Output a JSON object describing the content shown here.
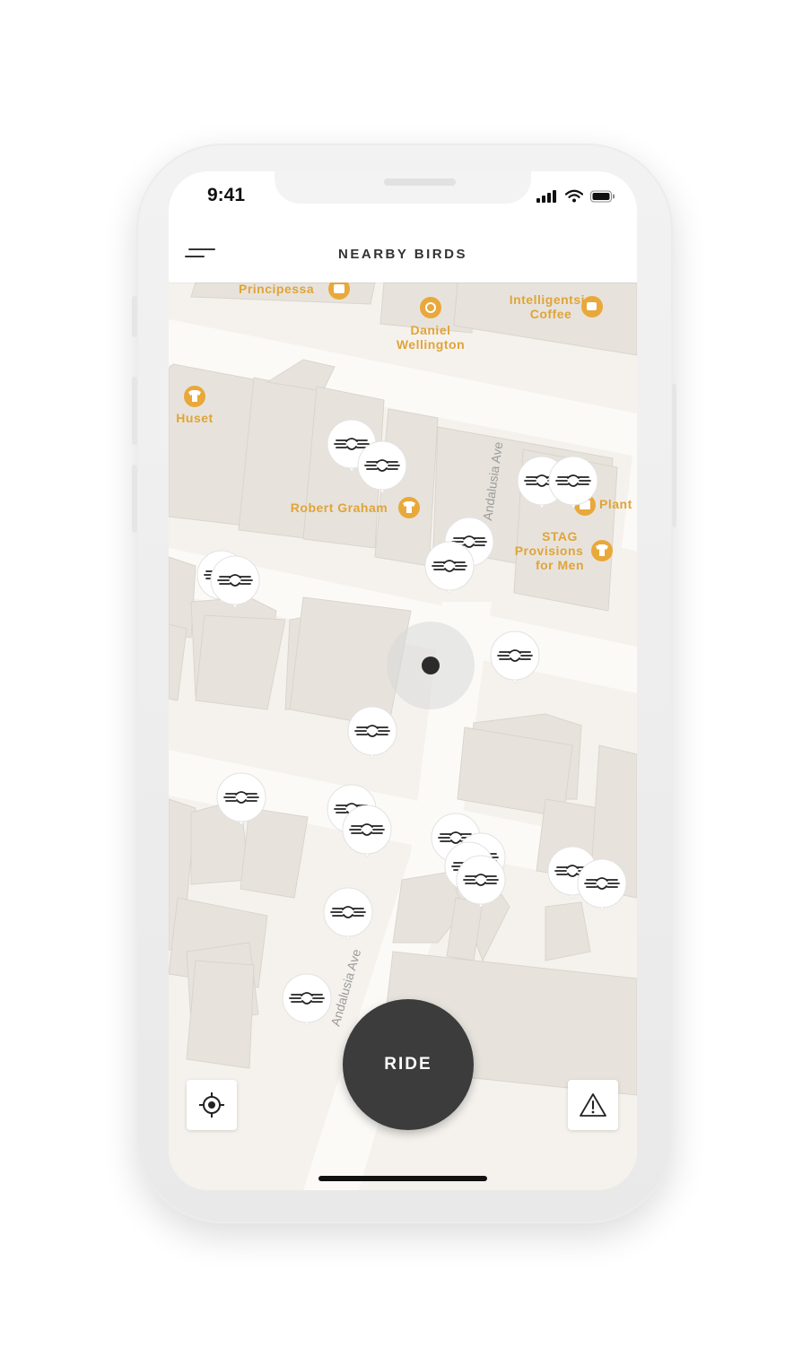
{
  "status_bar": {
    "time": "9:41"
  },
  "header": {
    "title": "NEARBY BIRDS",
    "menu_icon": "menu-icon"
  },
  "map": {
    "pois": [
      {
        "label": "Principessa",
        "icon": "bag-icon"
      },
      {
        "label": "Daniel",
        "label2": "Wellington",
        "icon": "watch-icon"
      },
      {
        "label": "Intelligentsia",
        "label2": "Coffee",
        "icon": "coffee-icon"
      },
      {
        "label": "Huset",
        "icon": "tshirt-icon"
      },
      {
        "label": "Robert Graham",
        "icon": "tshirt-icon"
      },
      {
        "label": "Plant",
        "icon": "store-icon"
      },
      {
        "label": "STAG",
        "label2": "Provisions",
        "label3": "for Men",
        "icon": "tshirt-icon"
      }
    ],
    "streets": [
      "Andalusia Ave",
      "Andalusia Ave"
    ],
    "scooter_count": 23,
    "scooter_icon": "bird-scooter-icon",
    "user_location_icon": "user-location-icon"
  },
  "controls": {
    "ride_label": "RIDE",
    "locate_icon": "locate-icon",
    "report_icon": "warning-icon"
  },
  "colors": {
    "map_bg": "#f5f2ed",
    "building": "#e7e3dc",
    "poi_text": "#e0a438",
    "ride_button": "#3c3c3c"
  }
}
